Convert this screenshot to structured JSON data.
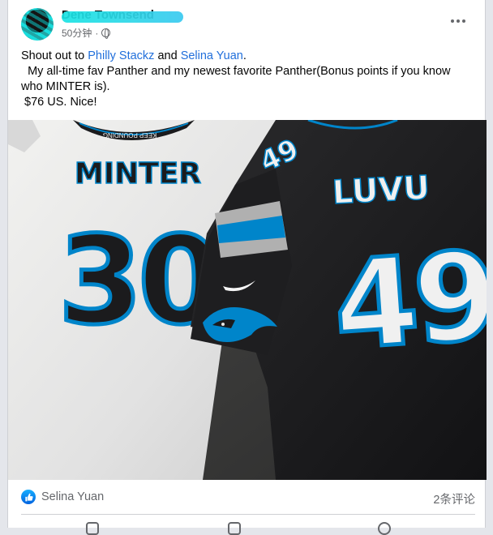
{
  "post": {
    "author": "Dene Townsend",
    "time": "50分钟",
    "separator": "·",
    "text": {
      "line1_prefix": "Shout out to ",
      "mention1": "Philly Stackz",
      "line1_and": " and ",
      "mention2": "Selina Yuan",
      "line1_suffix": ".",
      "line2": "  My all-time fav Panther and my newest favorite Panther(Bonus points if you know who MINTER is).",
      "line3": " $76 US. Nice!"
    },
    "photo": {
      "left_jersey": {
        "name": "MINTER",
        "number": "30",
        "collar_text": "KEEP POUNDING"
      },
      "right_jersey": {
        "name": "LUVU",
        "number": "49",
        "sleeve_number": "49"
      }
    }
  },
  "reactions": {
    "reactor": "Selina Yuan",
    "comments": "2条评论"
  },
  "colors": {
    "mention": "#216fdb",
    "panther_blue": "#0085ca",
    "jersey_black": "#1b1b1d",
    "jersey_white": "#ececec"
  },
  "icons": [
    "globe-icon",
    "more-icon",
    "like-icon",
    "nike-swoosh-icon",
    "panther-logo-icon"
  ]
}
